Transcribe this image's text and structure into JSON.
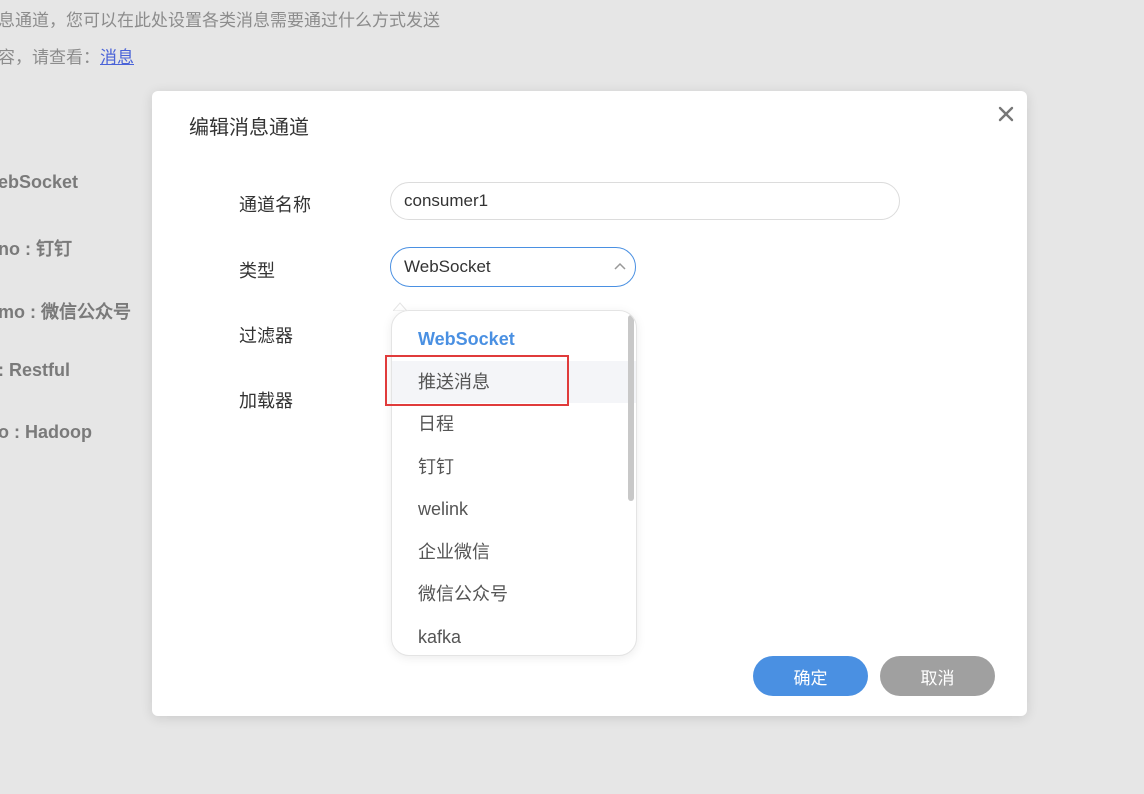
{
  "background": {
    "desc_line1": "息通道，您可以在此处设置各类消息需要通过什么方式发送",
    "desc_line2_prefix": "容，请查看：",
    "desc_line2_link": "消息",
    "items": [
      "ebSocket",
      "no : 钉钉",
      "mo : 微信公众号",
      ": Restful",
      "o : Hadoop"
    ]
  },
  "dialog": {
    "title": "编辑消息通道",
    "close_icon": "close-icon"
  },
  "form": {
    "channel_name_label": "通道名称",
    "channel_name_value": "consumer1",
    "type_label": "类型",
    "type_value": "WebSocket",
    "filter_label": "过滤器",
    "loader_label": "加载器"
  },
  "dropdown": {
    "options": [
      "WebSocket",
      "推送消息",
      "日程",
      "钉钉",
      "welink",
      "企业微信",
      "微信公众号",
      "kafka"
    ],
    "selected_index": 0,
    "hovered_index": 1
  },
  "buttons": {
    "confirm": "确定",
    "cancel": "取消"
  },
  "colors": {
    "accent": "#4a90e2",
    "highlight_border": "#e03b3b",
    "cancel_bg": "#a0a0a0"
  }
}
